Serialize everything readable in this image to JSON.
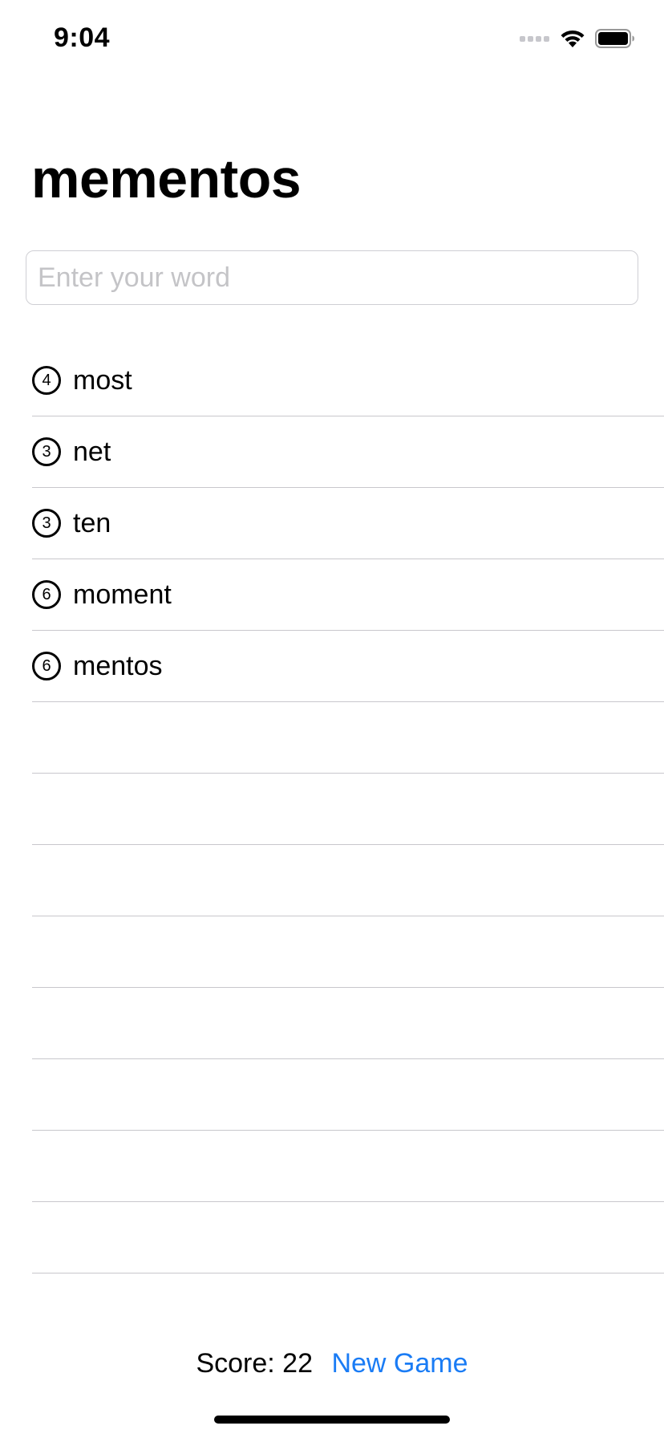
{
  "status_bar": {
    "time": "9:04",
    "icons": [
      "signal-icon",
      "wifi-icon",
      "battery-icon"
    ]
  },
  "header": {
    "title": "mementos"
  },
  "input": {
    "placeholder": "Enter your word",
    "value": ""
  },
  "words": [
    {
      "count": "4",
      "word": "most"
    },
    {
      "count": "3",
      "word": "net"
    },
    {
      "count": "3",
      "word": "ten"
    },
    {
      "count": "6",
      "word": "moment"
    },
    {
      "count": "6",
      "word": "mentos"
    },
    {
      "count": "",
      "word": ""
    },
    {
      "count": "",
      "word": ""
    },
    {
      "count": "",
      "word": ""
    },
    {
      "count": "",
      "word": ""
    },
    {
      "count": "",
      "word": ""
    },
    {
      "count": "",
      "word": ""
    },
    {
      "count": "",
      "word": ""
    },
    {
      "count": "",
      "word": ""
    }
  ],
  "footer": {
    "score_label": "Score: 22",
    "new_game_label": "New Game"
  },
  "colors": {
    "accent": "#1a7cf5",
    "separator": "#c8c7cc",
    "placeholder": "#c4c4c7"
  }
}
